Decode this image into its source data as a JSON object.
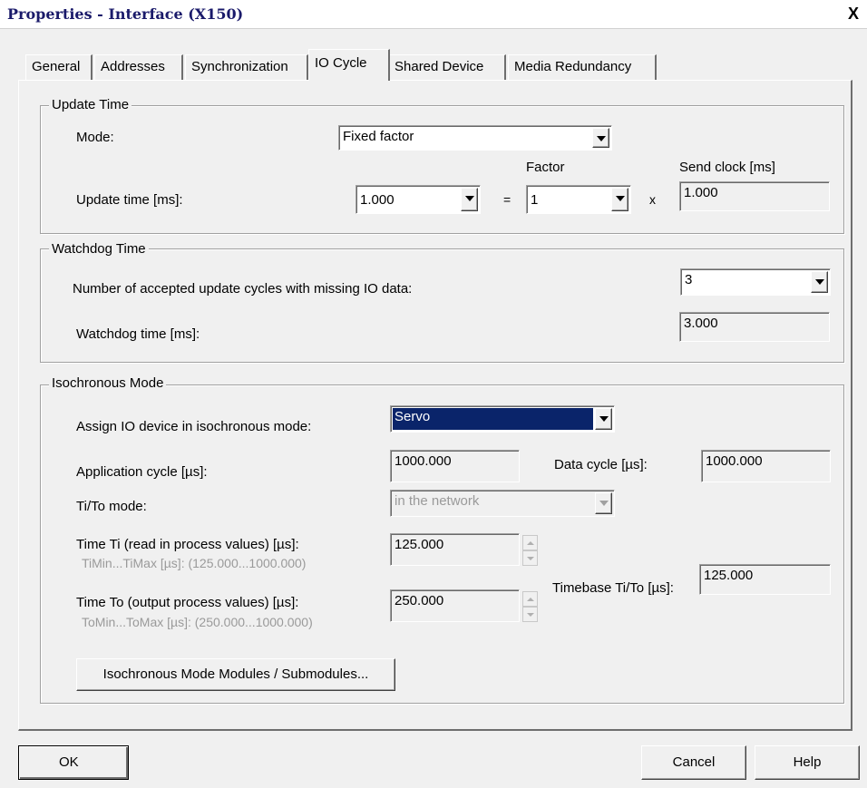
{
  "window": {
    "title": "Properties - Interface (X150)",
    "close_label": "X"
  },
  "tabs": [
    {
      "label": "General"
    },
    {
      "label": "Addresses"
    },
    {
      "label": "Synchronization"
    },
    {
      "label": "IO Cycle",
      "active": true
    },
    {
      "label": "Shared Device"
    },
    {
      "label": "Media Redundancy"
    }
  ],
  "update_time": {
    "legend": "Update Time",
    "mode_label": "Mode:",
    "mode_value": "Fixed factor",
    "factor_header": "Factor",
    "send_clock_header": "Send clock [ms]",
    "update_time_label": "Update time [ms]:",
    "update_time_value": "1.000",
    "equals": "=",
    "factor_value": "1",
    "times": "x",
    "send_clock_value": "1.000"
  },
  "watchdog": {
    "legend": "Watchdog Time",
    "cycles_label": "Number of accepted update cycles with missing IO data:",
    "cycles_value": "3",
    "watchdog_label": "Watchdog time [ms]:",
    "watchdog_value": "3.000"
  },
  "isochronous": {
    "legend": "Isochronous Mode",
    "assign_label": "Assign IO device in isochronous mode:",
    "assign_value": "Servo",
    "app_cycle_label": "Application cycle [µs]:",
    "app_cycle_value": "1000.000",
    "data_cycle_label": "Data cycle [µs]:",
    "data_cycle_value": "1000.000",
    "tito_mode_label": "Ti/To mode:",
    "tito_mode_value": "in the network",
    "ti_label": "Time Ti (read in process values) [µs]:",
    "ti_range": "TiMin...TiMax [µs]:   (125.000...1000.000)",
    "ti_value": "125.000",
    "to_label": "Time To (output process values) [µs]:",
    "to_range": "ToMin...ToMax [µs]: (250.000...1000.000)",
    "to_value": "250.000",
    "timebase_label": "Timebase Ti/To [µs]:",
    "timebase_value": "125.000",
    "modules_button": "Isochronous Mode Modules / Submodules..."
  },
  "footer": {
    "ok": "OK",
    "cancel": "Cancel",
    "help": "Help"
  },
  "colors": {
    "selection": "#0a246a",
    "title_text": "#1a1a6a",
    "face": "#f0f0f0"
  }
}
